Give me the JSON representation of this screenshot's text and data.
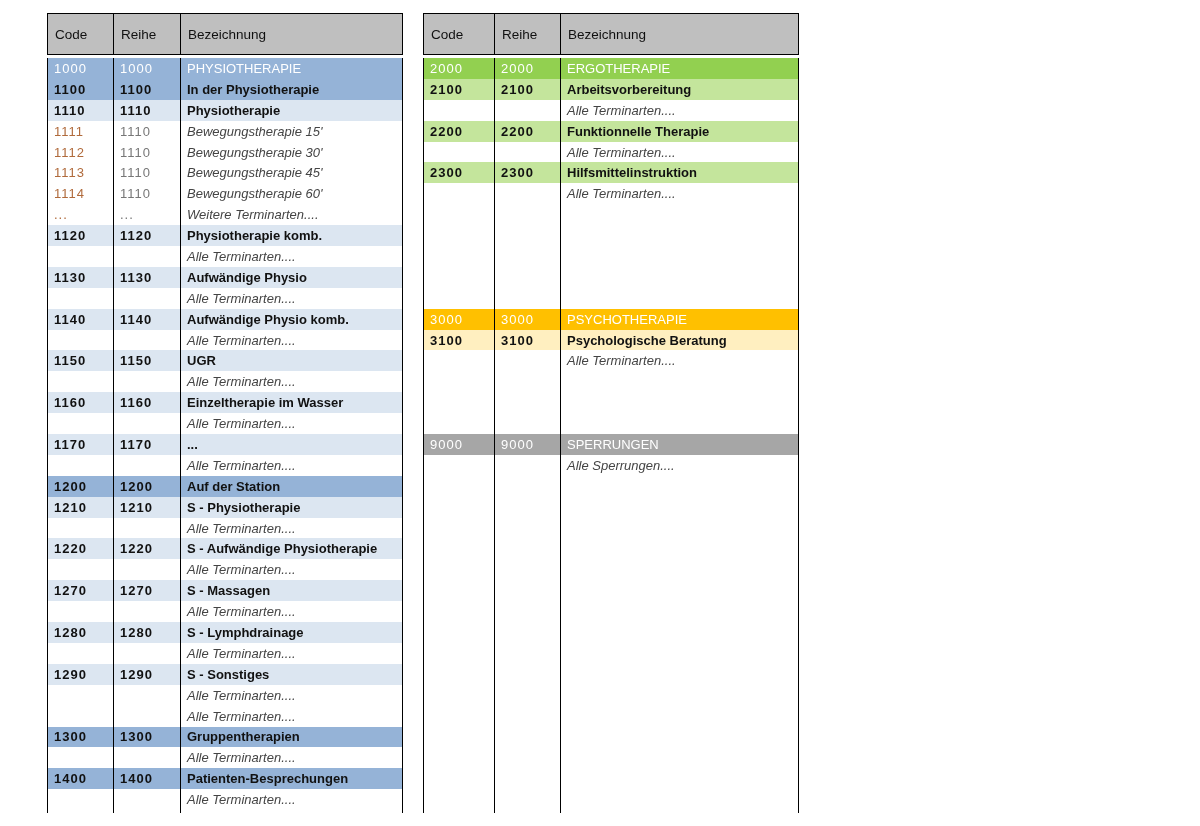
{
  "tables": [
    {
      "columns": [
        "Code",
        "Reihe",
        "Bezeichnung"
      ],
      "rows": [
        {
          "kind": "category",
          "color": "#95b3d7",
          "code": "1000",
          "reihe": "1000",
          "label": "PHYSIOTHERAPIE"
        },
        {
          "kind": "group",
          "color": "#95b3d7",
          "code": "1100",
          "reihe": "1100",
          "label": "In der Physiotherapie"
        },
        {
          "kind": "item",
          "color": "#dce6f1",
          "code": "1110",
          "reihe": "1110",
          "label": "Physiotherapie"
        },
        {
          "kind": "sub",
          "code": "1111",
          "reihe": "1110",
          "label": "Bewegungstherapie 15'"
        },
        {
          "kind": "sub",
          "code": "1112",
          "reihe": "1110",
          "label": "Bewegungstherapie 30'"
        },
        {
          "kind": "sub",
          "code": "1113",
          "reihe": "1110",
          "label": "Bewegungstherapie 45'"
        },
        {
          "kind": "sub",
          "code": "1114",
          "reihe": "1110",
          "label": "Bewegungstherapie 60'"
        },
        {
          "kind": "sub",
          "code": "...",
          "reihe": "...",
          "label": "Weitere Terminarten...."
        },
        {
          "kind": "item",
          "color": "#dce6f1",
          "code": "1120",
          "reihe": "1120",
          "label": "Physiotherapie komb."
        },
        {
          "kind": "note",
          "label": "Alle Terminarten...."
        },
        {
          "kind": "item",
          "color": "#dce6f1",
          "code": "1130",
          "reihe": "1130",
          "label": "Aufwändige Physio"
        },
        {
          "kind": "note",
          "label": "Alle Terminarten...."
        },
        {
          "kind": "item",
          "color": "#dce6f1",
          "code": "1140",
          "reihe": "1140",
          "label": "Aufwändige Physio komb."
        },
        {
          "kind": "note",
          "label": "Alle Terminarten...."
        },
        {
          "kind": "item",
          "color": "#dce6f1",
          "code": "1150",
          "reihe": "1150",
          "label": "UGR"
        },
        {
          "kind": "note",
          "label": "Alle Terminarten...."
        },
        {
          "kind": "item",
          "color": "#dce6f1",
          "code": "1160",
          "reihe": "1160",
          "label": "Einzeltherapie im Wasser"
        },
        {
          "kind": "note",
          "label": "Alle Terminarten...."
        },
        {
          "kind": "item",
          "color": "#dce6f1",
          "code": "1170",
          "reihe": "1170",
          "label": "..."
        },
        {
          "kind": "note",
          "label": "Alle Terminarten...."
        },
        {
          "kind": "group",
          "color": "#95b3d7",
          "code": "1200",
          "reihe": "1200",
          "label": "Auf der Station"
        },
        {
          "kind": "item",
          "color": "#dce6f1",
          "code": "1210",
          "reihe": "1210",
          "label": "S - Physiotherapie"
        },
        {
          "kind": "note",
          "label": "Alle Terminarten...."
        },
        {
          "kind": "item",
          "color": "#dce6f1",
          "code": "1220",
          "reihe": "1220",
          "label": "S - Aufwändige Physiotherapie"
        },
        {
          "kind": "note",
          "label": "Alle Terminarten...."
        },
        {
          "kind": "item",
          "color": "#dce6f1",
          "code": "1270",
          "reihe": "1270",
          "label": "S - Massagen"
        },
        {
          "kind": "note",
          "label": "Alle Terminarten...."
        },
        {
          "kind": "item",
          "color": "#dce6f1",
          "code": "1280",
          "reihe": "1280",
          "label": "S - Lymphdrainage"
        },
        {
          "kind": "note",
          "label": "Alle Terminarten...."
        },
        {
          "kind": "item",
          "color": "#dce6f1",
          "code": "1290",
          "reihe": "1290",
          "label": "S - Sonstiges"
        },
        {
          "kind": "note",
          "label": "Alle Terminarten...."
        },
        {
          "kind": "note",
          "label": "Alle Terminarten...."
        },
        {
          "kind": "group",
          "color": "#95b3d7",
          "code": "1300",
          "reihe": "1300",
          "label": "Gruppentherapien"
        },
        {
          "kind": "note",
          "label": "Alle Terminarten...."
        },
        {
          "kind": "group",
          "color": "#95b3d7",
          "code": "1400",
          "reihe": "1400",
          "label": "Patienten-Besprechungen"
        },
        {
          "kind": "note",
          "label": "Alle Terminarten...."
        }
      ]
    },
    {
      "columns": [
        "Code",
        "Reihe",
        "Bezeichnung"
      ],
      "rows": [
        {
          "kind": "category",
          "color": "#92d050",
          "code": "2000",
          "reihe": "2000",
          "label": "ERGOTHERAPIE"
        },
        {
          "kind": "item",
          "color": "#c4e59c",
          "code": "2100",
          "reihe": "2100",
          "label": "Arbeitsvorbereitung"
        },
        {
          "kind": "note",
          "label": "Alle Terminarten...."
        },
        {
          "kind": "item",
          "color": "#c4e59c",
          "code": "2200",
          "reihe": "2200",
          "label": "Funktionnelle Therapie"
        },
        {
          "kind": "note",
          "label": "Alle Terminarten...."
        },
        {
          "kind": "item",
          "color": "#c4e59c",
          "code": "2300",
          "reihe": "2300",
          "label": "Hilfsmittelinstruktion"
        },
        {
          "kind": "note",
          "label": "Alle Terminarten...."
        },
        {
          "kind": "blank"
        },
        {
          "kind": "blank"
        },
        {
          "kind": "blank"
        },
        {
          "kind": "blank"
        },
        {
          "kind": "blank"
        },
        {
          "kind": "category",
          "color": "#ffc000",
          "code": "3000",
          "reihe": "3000",
          "label": "PSYCHOTHERAPIE"
        },
        {
          "kind": "item",
          "color": "#ffefc0",
          "code": "3100",
          "reihe": "3100",
          "label": "Psychologische Beratung"
        },
        {
          "kind": "note",
          "label": "Alle Terminarten...."
        },
        {
          "kind": "blank"
        },
        {
          "kind": "blank"
        },
        {
          "kind": "blank"
        },
        {
          "kind": "category",
          "color": "#a6a6a6",
          "code": "9000",
          "reihe": "9000",
          "label": "SPERRUNGEN"
        },
        {
          "kind": "note",
          "label": "Alle Sperrungen...."
        }
      ]
    }
  ]
}
